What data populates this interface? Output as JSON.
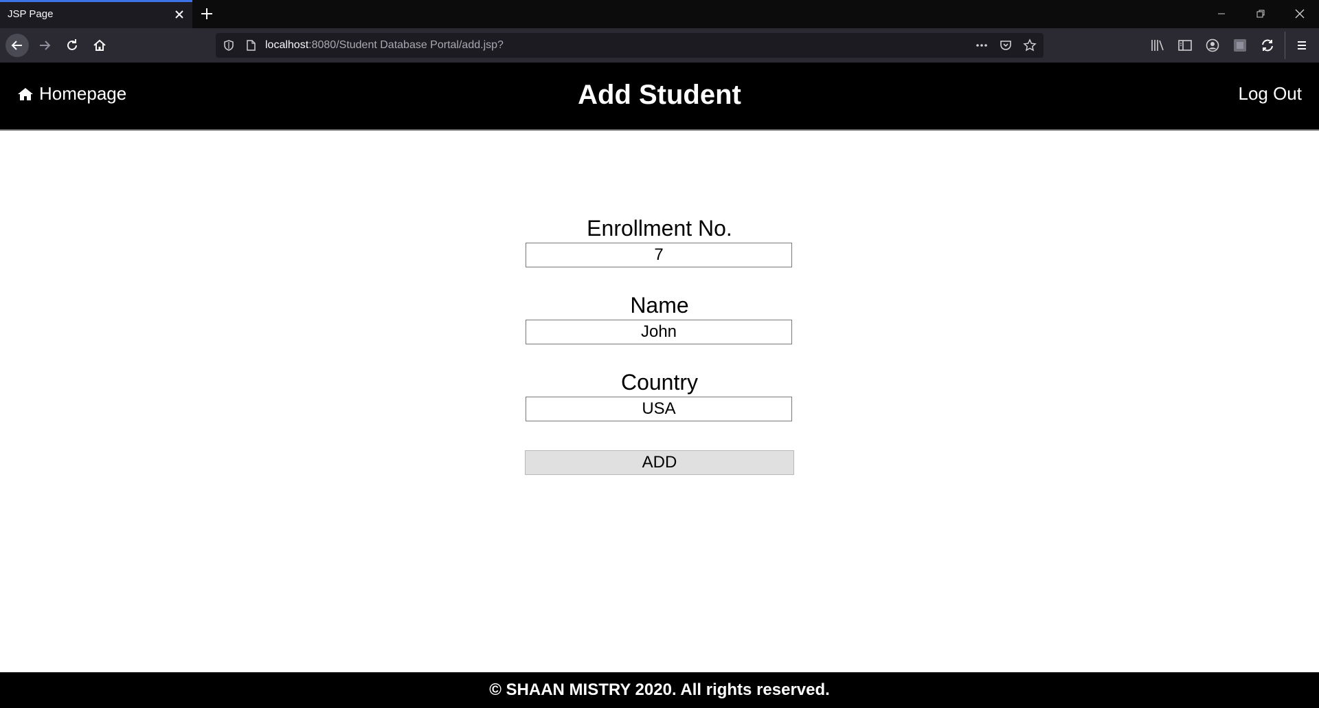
{
  "browser": {
    "tab_title": "JSP Page",
    "url_host": "localhost",
    "url_rest": ":8080/Student Database Portal/add.jsp?",
    "accent_color": "#3b73e8"
  },
  "header": {
    "home_label": "Homepage",
    "title": "Add Student",
    "logout_label": "Log Out"
  },
  "form": {
    "enrollment_label": "Enrollment No.",
    "enrollment_value": "7",
    "name_label": "Name",
    "name_value": "John",
    "country_label": "Country",
    "country_value": "USA",
    "submit_label": "ADD"
  },
  "footer": {
    "text": "© SHAAN MISTRY 2020. All rights reserved."
  }
}
